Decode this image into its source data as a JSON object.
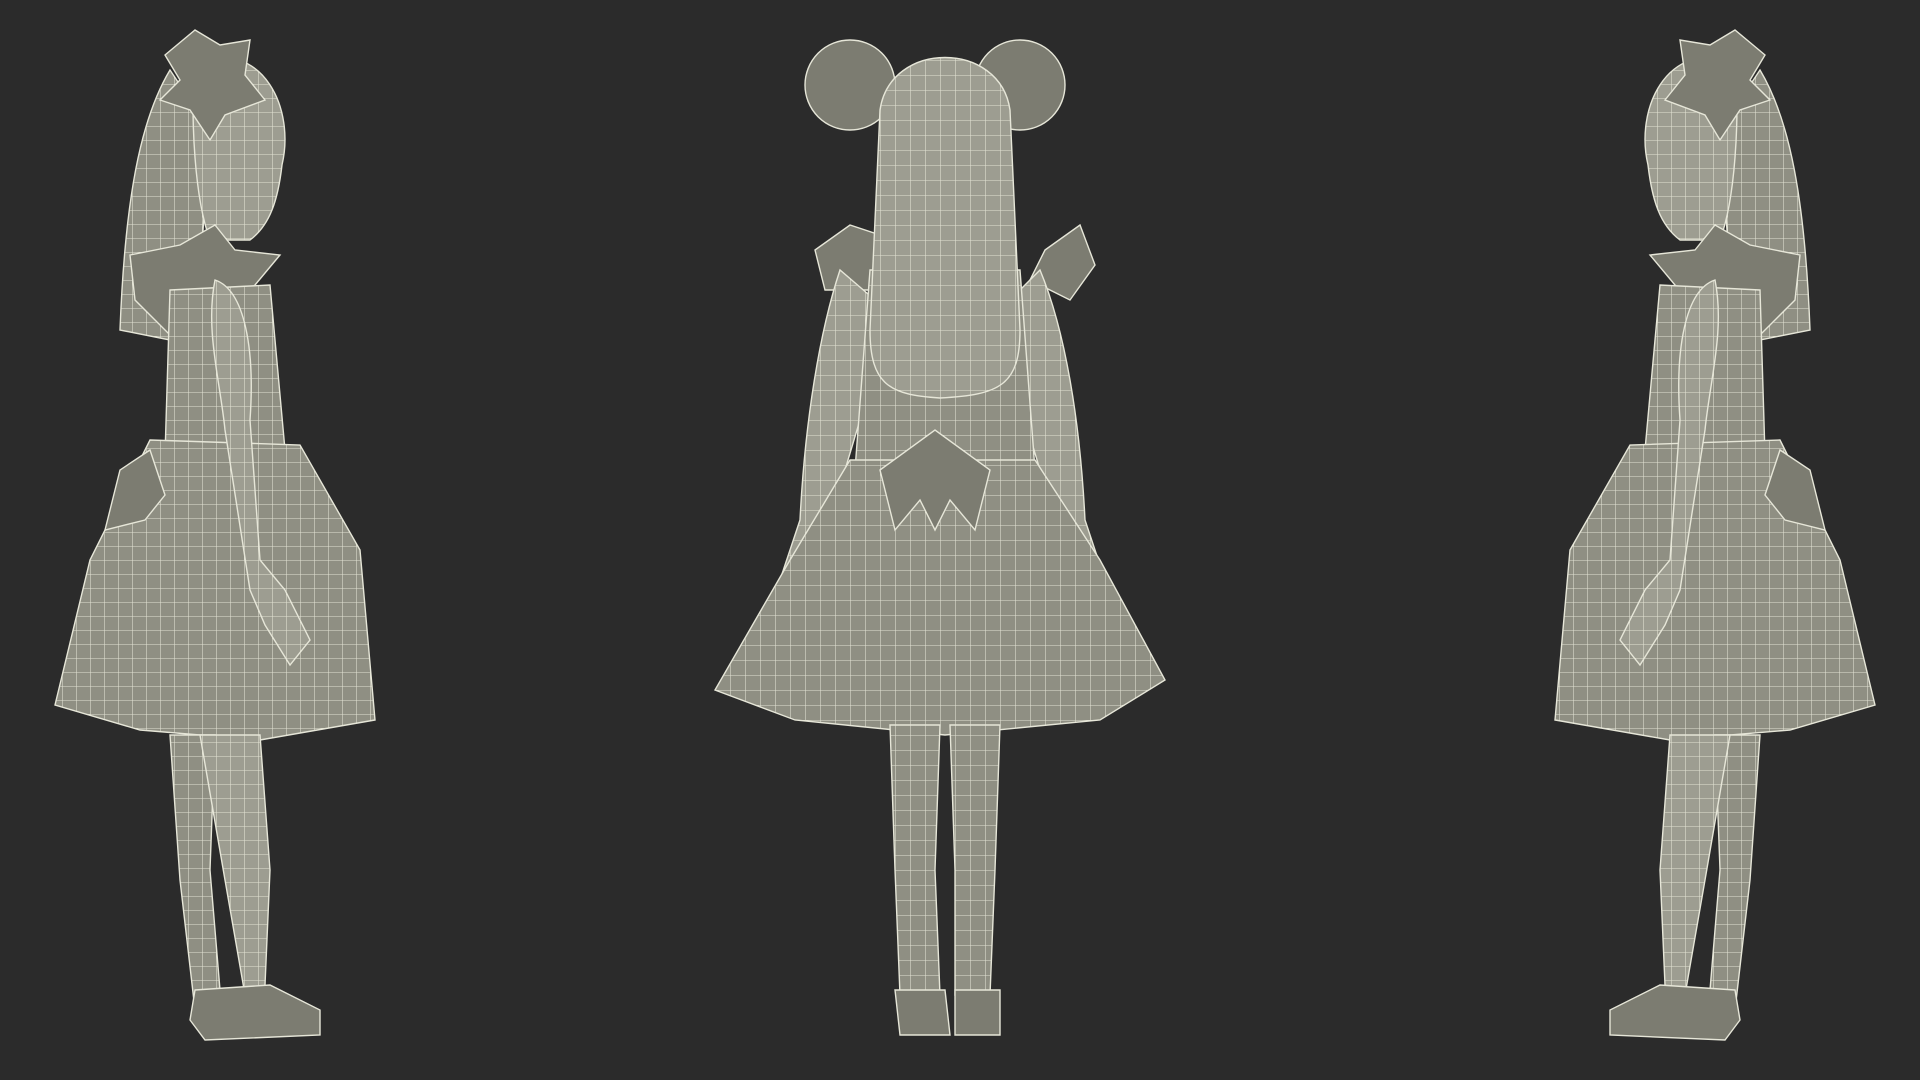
{
  "scene": {
    "background_color": "#2b2b2b",
    "mesh_fill_color": "#8f8f83",
    "wireframe_color": "#ecebdc",
    "views": [
      {
        "name": "side-view-left-facing-right"
      },
      {
        "name": "back-view"
      },
      {
        "name": "side-view-right-facing-left"
      }
    ]
  }
}
